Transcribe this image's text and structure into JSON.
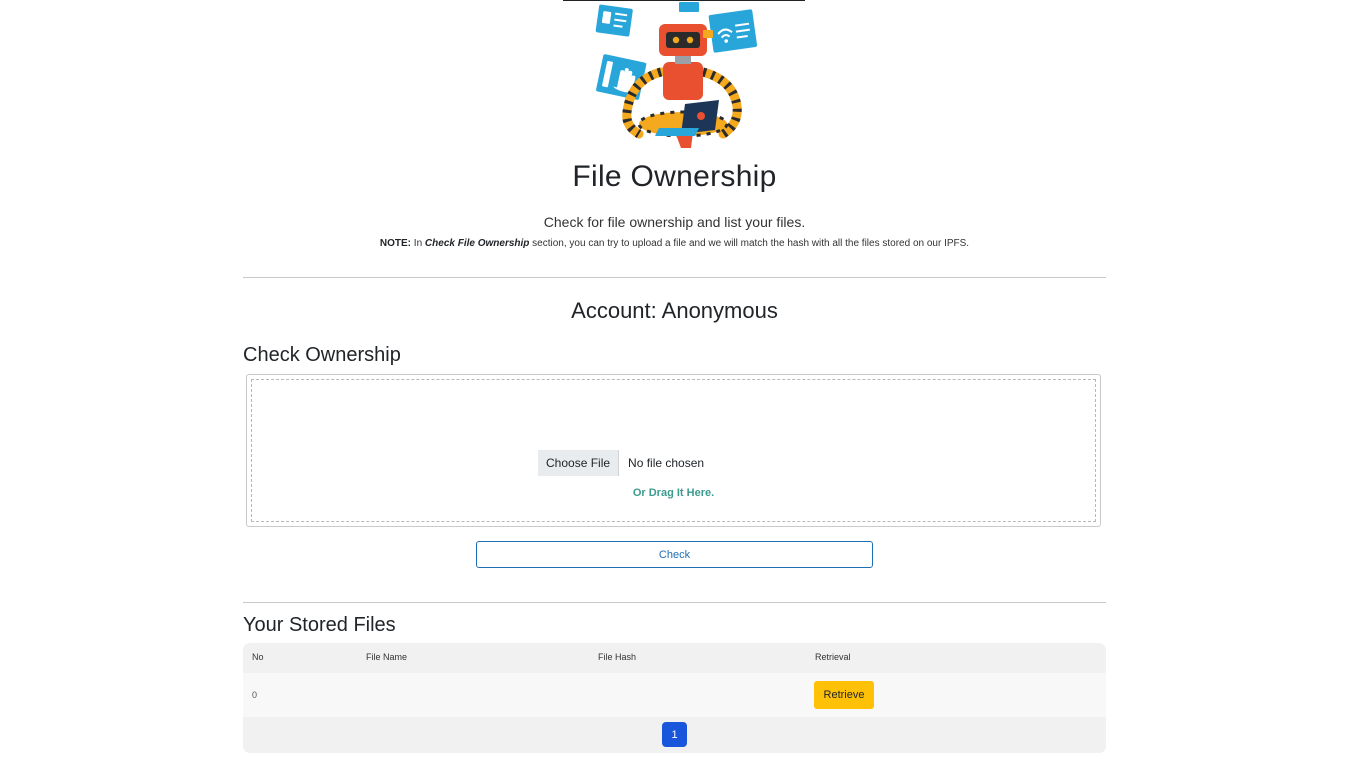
{
  "header": {
    "title": "File Ownership",
    "subtitle": "Check for file ownership and list your files.",
    "note_label": "NOTE:",
    "note_pre": " In ",
    "note_emphasis": "Check File Ownership",
    "note_post": " section, you can try to upload a file and we will match the hash with all the files stored on our IPFS."
  },
  "account": {
    "text": "Account: Anonymous"
  },
  "check_section": {
    "title": "Check Ownership",
    "choose_file_label": "Choose File",
    "no_file_text": "No file chosen",
    "drag_hint": "Or Drag It Here.",
    "check_button": "Check"
  },
  "stored_files": {
    "title": "Your Stored Files",
    "columns": [
      "No",
      "File Name",
      "File Hash",
      "Retrieval"
    ],
    "rows": [
      {
        "no": "0",
        "file_name": "",
        "file_hash": "",
        "retrieval": "Retrieve"
      }
    ],
    "pagination": {
      "current_page": "1"
    }
  },
  "colors": {
    "accent_blue": "#1f6fb5",
    "retrieve_yellow": "#ffc107",
    "page_active": "#1a56db",
    "drag_hint": "#3d9a8f",
    "robot_orange": "#e8502f",
    "screen_cyan": "#29a6d9"
  },
  "icons": {
    "hero": "robot-with-laptop-illustration"
  }
}
